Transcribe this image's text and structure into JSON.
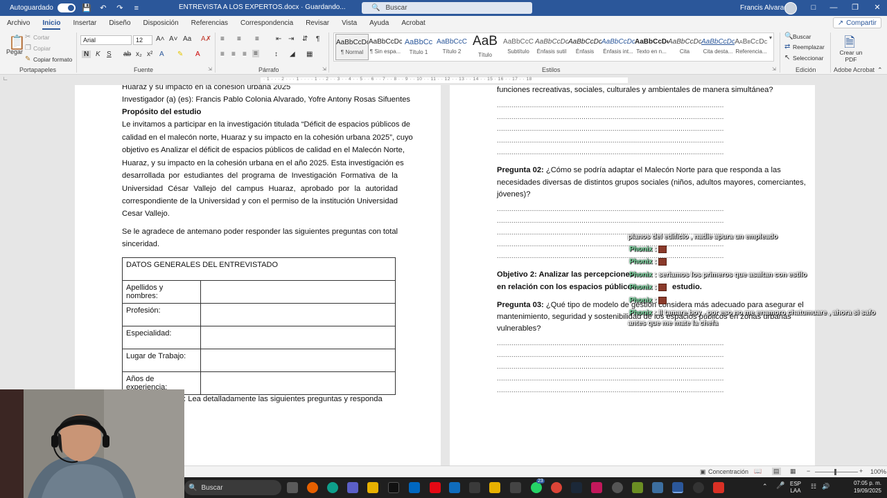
{
  "titlebar": {
    "autosave_label": "Autoguardado",
    "doc_title": "ENTREVISTA A LOS EXPERTOS.docx  ·  Guardando...",
    "search_placeholder": "Buscar",
    "user_name": "Francis Alvarado"
  },
  "tabs": [
    "Archivo",
    "Inicio",
    "Insertar",
    "Diseño",
    "Disposición",
    "Referencias",
    "Correspondencia",
    "Revisar",
    "Vista",
    "Ayuda",
    "Acrobat"
  ],
  "share_label": "Compartir",
  "ribbon": {
    "clipboard": {
      "paste": "Pegar",
      "cut": "Cortar",
      "copy": "Copiar",
      "format_painter": "Copiar formato",
      "label": "Portapapeles"
    },
    "font": {
      "family": "Arial",
      "size": "12",
      "label": "Fuente"
    },
    "paragraph": {
      "label": "Párrafo"
    },
    "styles": {
      "label": "Estilos",
      "items": [
        {
          "preview": "AaBbCcDc",
          "name": "¶ Normal"
        },
        {
          "preview": "AaBbCcDc",
          "name": "¶ Sin espa..."
        },
        {
          "preview": "AaBbCc",
          "name": "Título 1"
        },
        {
          "preview": "AaBbCcC",
          "name": "Título 2"
        },
        {
          "preview": "AaB",
          "name": "Título"
        },
        {
          "preview": "AaBbCcC",
          "name": "Subtítulo"
        },
        {
          "preview": "AaBbCcDc",
          "name": "Énfasis sutil"
        },
        {
          "preview": "AaBbCcDc",
          "name": "Énfasis"
        },
        {
          "preview": "AaBbCcDc",
          "name": "Énfasis int..."
        },
        {
          "preview": "AaBbCcDc",
          "name": "Texto en n..."
        },
        {
          "preview": "AaBbCcDc",
          "name": "Cita"
        },
        {
          "preview": "AaBbCcDc",
          "name": "Cita desta..."
        },
        {
          "preview": "AaBbCcDc",
          "name": "Referencia..."
        }
      ]
    },
    "editing": {
      "find": "Buscar",
      "replace": "Reemplazar",
      "select": "Seleccionar",
      "label": "Edición"
    },
    "acrobat": {
      "create_pdf": "Crear un PDF",
      "label": "Adobe Acrobat"
    }
  },
  "ruler_marks": "· 1 · · · 2 · · · 1 · · · · 1 · · 2 · · 3 · · 4 · · 5 · · 6 · · 7 · · 8 · · 9 · · 10 · · 11 · · 12 · · 13 · · 14 · · 15 · 16 · · 17 · · 18",
  "left_page": {
    "line1": "Huaraz y su impacto en la cohesión urbana 2025",
    "line2": "Investigador (a) (es): Francis Pablo Colonia Alvarado, Yofre Antony Rosas Sifuentes",
    "purpose_heading": "Propósito del estudio",
    "para1": [
      "Le invitamos a participar en la investigación titulada “Déficit de espacios públicos de",
      "calidad en el malecón norte, Huaraz y su impacto en la cohesión urbana 2025”, cuyo",
      "objetivo es Analizar el déficit de espacios públicos de calidad en el Malecón Norte,",
      "Huaraz, y su impacto en la cohesión urbana en el año 2025. Esta investigación es",
      "desarrollada por estudiantes del programa de Investigación Formativa de la",
      "Universidad César Vallejo del campus Huaraz, aprobado por la autoridad",
      "correspondiente de la Universidad y con el permiso de la institución Universidad"
    ],
    "para1_last": "Cesar Vallejo.",
    "para2": [
      "Se le agradece de antemano poder responder las siguientes preguntas con total"
    ],
    "para2_last": "sinceridad.",
    "table_header": "DATOS GENERALES DEL ENTREVISTADO",
    "table_rows": [
      "Apellidos y nombres:",
      "Profesión:",
      "Especialidad:",
      "Lugar de Trabajo:",
      "Años de experiencia:"
    ],
    "bottom_line": ": Lea detalladamente las siguientes preguntas y responda"
  },
  "right_page": {
    "top_line": "funciones recreativas, sociales, culturales y ambientales de manera simultánea?",
    "dots": "..............................................................................................................",
    "q2_label": "Pregunta 02:",
    "q2_lines": [
      " ¿Cómo se podría adaptar el Malecón Norte para que responda a las",
      "necesidades diversas de distintos grupos sociales (niños, adultos mayores, comerciantes,"
    ],
    "q2_last": "jóvenes)?",
    "obj2_line1": "Objetivo 2: Analizar las percepciones,",
    "obj2_line2": "en relación con los espacios públicos",
    "obj2_tail": "estudio.",
    "q3_label": "Pregunta 03:",
    "q3_line1": " ¿Qué tipo de modelo de gestión considera más adecuado para asegurar el",
    "q3_line2": "mantenimiento, seguridad y sostenibilidad de los espacios públicos en zonas urbanas",
    "q3_last": "vulnerables?"
  },
  "chat_overlay": {
    "nick": "Phonix",
    "m1": "planos del edificio , nadie apura un empleado",
    "m3": "seriamos los primeros que asaltan con estilo",
    "m6a": "Il tamare boy , por eso no me enamoro chatumuare , ahora si safo",
    "m6b": "antes que me mate la chefa"
  },
  "statusbar": {
    "focus": "Concentración",
    "zoom": "100%"
  },
  "taskbar": {
    "search": "Buscar",
    "lang1": "ESP",
    "lang2": "LAA",
    "time": "07:05 p. m.",
    "date": "19/09/2025",
    "badge": "23"
  },
  "colors": {
    "word_blue": "#2b579a",
    "chat_nick": "#7fe0a6"
  }
}
